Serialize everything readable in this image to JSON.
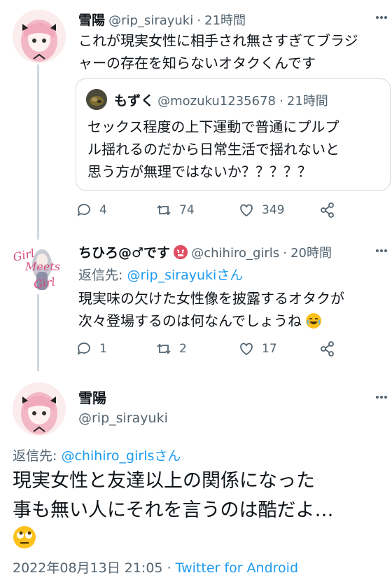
{
  "tweet1": {
    "name": "雪陽",
    "handle": "@rip_sirayuki",
    "time": "21時間",
    "text_line1": "これが現実女性に相手され無さすぎてブラジ",
    "text_line2": "ャーの存在を知らないオタクくんです",
    "quote": {
      "name": "もずく",
      "handle": "@mozuku1235678",
      "time": "21時間",
      "line1": "セックス程度の上下運動で普通にプルプ",
      "line2": "ル揺れるのだから日常生活で揺れないと",
      "line3": "思う方が無理ではないか？？？？？"
    },
    "replies": "4",
    "retweets": "74",
    "likes": "349"
  },
  "tweet2": {
    "name": "ちひろ@♂です",
    "handle": "@chihiro_girls",
    "time": "20時間",
    "reply_prefix": "返信先: ",
    "reply_to": "@rip_sirayukiさん",
    "text_line1": "現実味の欠けた女性像を披露するオタクが",
    "text_line2": "次々登場するのは何なんでしょうね",
    "replies": "1",
    "retweets": "2",
    "likes": "17",
    "avatar_logo": "Girl Meets Girl"
  },
  "tweet3": {
    "name": "雪陽",
    "handle": "@rip_sirayuki",
    "reply_prefix": "返信先: ",
    "reply_to": "@chihiro_girlsさん",
    "text_line1": "現実女性と友達以上の関係になった",
    "text_line2": "事も無い人にそれを言うのは酷だよ…",
    "timestamp": "2022年08月13日 21:05",
    "separator": "·",
    "source": "Twitter for Android"
  },
  "colors": {
    "link": "#1d9bf0",
    "meta": "#536471",
    "thread_line": "#cfd9de"
  },
  "icons": [
    "reply-icon",
    "retweet-icon",
    "like-icon",
    "share-icon",
    "more-icon",
    "laugh-emoji",
    "angry-face-emoji",
    "eyes-roll-emoji"
  ]
}
